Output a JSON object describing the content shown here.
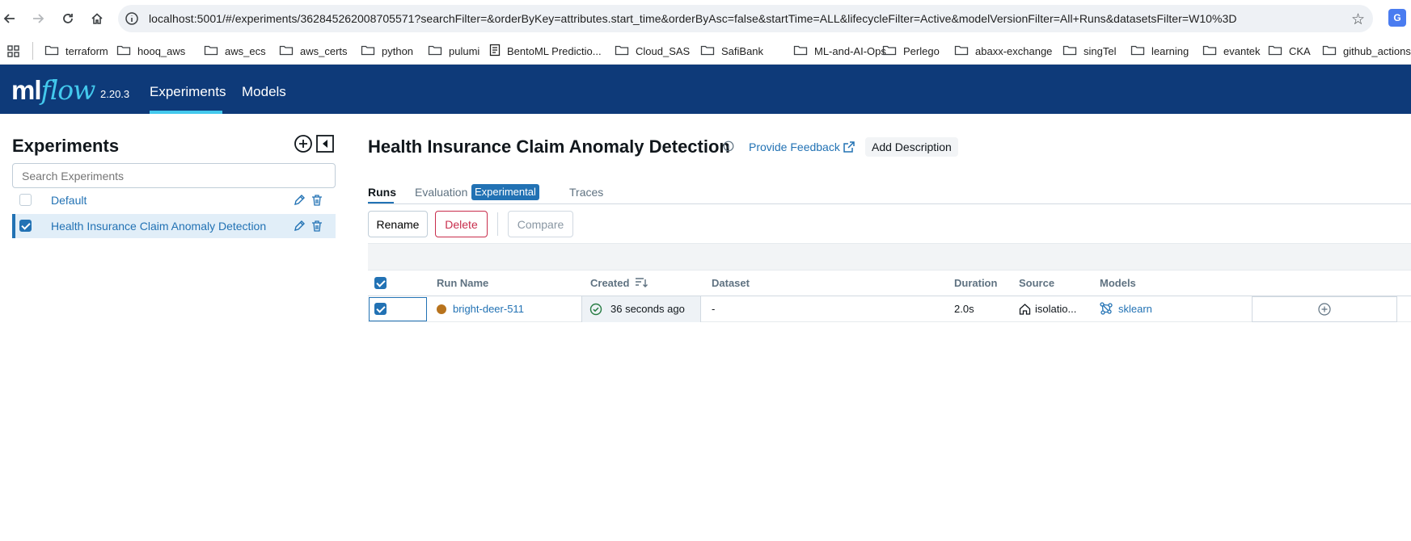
{
  "browser": {
    "url": "localhost:5001/#/experiments/362845262008705571?searchFilter=&orderByKey=attributes.start_time&orderByAsc=false&startTime=ALL&lifecycleFilter=Active&modelVersionFilter=All+Runs&datasetsFilter=W10%3D",
    "bookmarks": [
      "terraform",
      "hooq_aws",
      "aws_ecs",
      "aws_certs",
      "python",
      "pulumi",
      "BentoML Predictio...",
      "Cloud_SAS",
      "SafiBank",
      "ML-and-AI-Ops",
      "Perlego",
      "abaxx-exchange",
      "singTel",
      "learning",
      "evantek",
      "CKA",
      "github_actions"
    ]
  },
  "app": {
    "logo_ml": "ml",
    "logo_flow": "flow",
    "version": "2.20.3",
    "nav": [
      "Experiments",
      "Models"
    ],
    "active_nav": "Experiments"
  },
  "sidebar": {
    "title": "Experiments",
    "search_placeholder": "Search Experiments",
    "experiments": [
      {
        "name": "Default",
        "checked": false
      },
      {
        "name": "Health Insurance Claim Anomaly Detection",
        "checked": true
      }
    ]
  },
  "main": {
    "title": "Health Insurance Claim Anomaly Detection",
    "feedback": "Provide Feedback",
    "add_description": "Add Description",
    "tabs": {
      "runs": "Runs",
      "evaluation": "Evaluation",
      "badge": "Experimental",
      "traces": "Traces"
    },
    "toolbar": {
      "rename": "Rename",
      "delete": "Delete",
      "compare": "Compare"
    },
    "columns": [
      "Run Name",
      "Created",
      "Dataset",
      "Duration",
      "Source",
      "Models"
    ],
    "runs": [
      {
        "name": "bright-deer-511",
        "created": "36 seconds ago",
        "dataset": "-",
        "duration": "2.0s",
        "source": "isolatio...",
        "model": "sklearn",
        "color": "#b8731d"
      }
    ]
  },
  "colors": {
    "header": "#0e3a79",
    "accent": "#43c9ed",
    "link": "#2272b4",
    "danger": "#c82d4c"
  }
}
